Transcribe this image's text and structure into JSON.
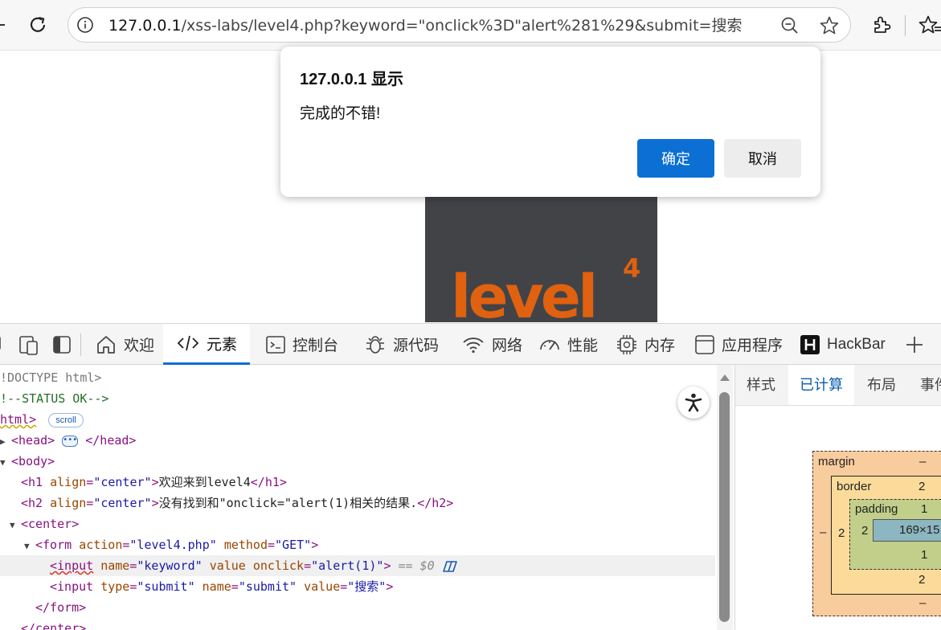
{
  "browser": {
    "url_host": "127.0.0.1",
    "url_rest": "/xss-labs/level4.php?keyword=\"onclick%3D\"alert%281%29&submit=搜索",
    "icons": [
      "reload-icon",
      "info-icon",
      "zoom-out-icon",
      "favorite-star-icon",
      "extensions-icon",
      "favorites-icon"
    ]
  },
  "dialog": {
    "title": "127.0.0.1 显示",
    "message": "完成的不错!",
    "ok_label": "确定",
    "cancel_label": "取消"
  },
  "page": {
    "logo_text": "level",
    "logo_sup": "4",
    "logo_color": "#e0610f",
    "logo_bg": "#424347"
  },
  "devtools": {
    "tabs": [
      {
        "label": "欢迎",
        "icon": "home-icon"
      },
      {
        "label": "元素",
        "icon": "code-icon"
      },
      {
        "label": "控制台",
        "icon": "console-icon"
      },
      {
        "label": "源代码",
        "icon": "bug-icon"
      },
      {
        "label": "网络",
        "icon": "wifi-icon"
      },
      {
        "label": "性能",
        "icon": "gauge-icon"
      },
      {
        "label": "内存",
        "icon": "chip-icon"
      },
      {
        "label": "应用程序",
        "icon": "app-icon"
      },
      {
        "label": "HackBar",
        "icon": "hackbar-icon"
      }
    ],
    "active_tab": "元素",
    "dom": {
      "doctype": "!DOCTYPE html>",
      "comment": "!--STATUS OK-->",
      "html_tag": "html>",
      "scroll_badge": "scroll",
      "head_open": "<head>",
      "head_close": "</head>",
      "body_open": "<body>",
      "h1": {
        "open": "<h1 ",
        "attr": "align",
        "eq": "=",
        "val": "\"center\"",
        "close": ">",
        "text": "欢迎来到level4",
        "end": "</h1>"
      },
      "h2": {
        "open": "<h2 ",
        "attr": "align",
        "eq": "=",
        "val": "\"center\"",
        "close": ">",
        "text": "没有找到和\"onclick=\"alert(1)相关的结果.",
        "end": "</h2>"
      },
      "center_open": "<center>",
      "form": {
        "open": "<form ",
        "attr1": "action",
        "val1": "\"level4.php\"",
        "attr2": "method",
        "val2": "\"GET\"",
        "close": ">"
      },
      "input1": {
        "open": "<input",
        "attr1": "name",
        "val1": "\"keyword\"",
        "attr2": "value",
        "attr3": "onclick",
        "val3": "\"alert(1)\"",
        "close": ">",
        "dollar": "== $0"
      },
      "input2": {
        "open": "<input ",
        "attr1": "type",
        "val1": "\"submit\"",
        "attr2": "name",
        "val2": "\"submit\"",
        "attr3": "value",
        "val3": "\"搜索\"",
        "close": ">"
      },
      "form_close": "</form>",
      "center_close": "</center>"
    },
    "side_tabs": [
      "样式",
      "已计算",
      "布局",
      "事件"
    ],
    "side_active": "已计算",
    "box_model": {
      "margin_label": "margin",
      "margin_top": "–",
      "margin_bottom": "–",
      "margin_left": "–",
      "border_label": "border",
      "border_top": "2",
      "border_bottom": "2",
      "border_left": "2",
      "padding_label": "padding",
      "padding_top": "1",
      "padding_bottom": "1",
      "padding_left": "2",
      "content": "169×15"
    }
  }
}
